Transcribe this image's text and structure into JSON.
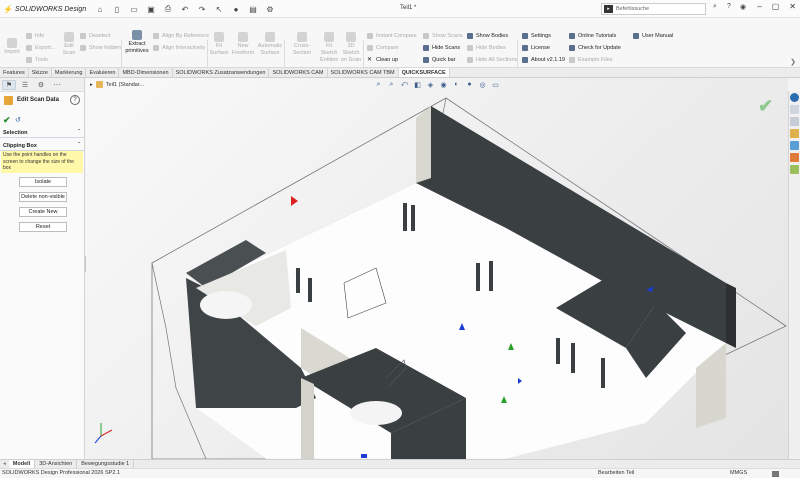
{
  "app": {
    "brand": "SOLIDWORKS Design",
    "document_title": "Teil1 *",
    "search_placeholder": "Befehlssuche",
    "quick_access_icons": [
      "home-icon",
      "new-document-icon",
      "open-icon",
      "save-icon",
      "print-icon",
      "undo-icon",
      "redo-icon",
      "select-icon",
      "rebuild-icon",
      "options-icon"
    ]
  },
  "ribbon": {
    "import_label": "Import",
    "info_label": "Info",
    "export_label": "Export...",
    "tools_label": "Tools",
    "edit_scan_label": "Edit\nScan",
    "deselect_label": "Deselect",
    "show_hidden_label": "Show hidden",
    "extract_primitives_label": "Extract\nprimitives",
    "align_by_reference_label": "Align By Reference",
    "align_interactively_label": "Align Interactively",
    "fit_surface_label": "Fit\nSurface",
    "new_freeform_label": "New\nFreeform",
    "automatic_surface_label": "Automatic\nSurface",
    "cross_section_label": "Cross-Section",
    "fit_sketch_label": "Fit\nSketch\nEntities",
    "sketch_on_scan_label": "3D\nSketch\non Scan",
    "instant_compare_label": "Instant Compare",
    "compare_label": "Compare",
    "clean_up_label": "Clean up",
    "show_scans_label": "Show Scans",
    "hide_scans_label": "Hide Scans",
    "quick_bar_label": "Quick bar",
    "show_bodies_label": "Show Bodies",
    "hide_bodies_label": "Hide Bodies",
    "hide_all_sections_label": "Hide All Sections",
    "settings_label": "Settings",
    "license_label": "License",
    "about_label": "About v2.1.19",
    "online_tutorials_label": "Online Tutorials",
    "check_update_label": "Check for Update",
    "example_files_label": "Example Files",
    "user_manual_label": "User Manual"
  },
  "tabs": [
    {
      "label": "Features",
      "selected": false
    },
    {
      "label": "Skizze",
      "selected": false
    },
    {
      "label": "Markierung",
      "selected": false
    },
    {
      "label": "Evaluieren",
      "selected": false
    },
    {
      "label": "MBD-Dimensionen",
      "selected": false
    },
    {
      "label": "SOLIDWORKS Zusatzanwendungen",
      "selected": false
    },
    {
      "label": "SOLIDWORKS CAM",
      "selected": false
    },
    {
      "label": "SOLIDWORKS CAM TBM",
      "selected": false
    },
    {
      "label": "QUICKSURFACE",
      "selected": true
    }
  ],
  "property_manager": {
    "title": "Edit Scan Data",
    "selection_label": "Selection",
    "clipping_box_label": "Clipping Box",
    "hint_text": "Use the point handles on the screen to change the size of the box",
    "buttons": [
      "Isolate",
      "Delete non-visible",
      "Create New",
      "Reset"
    ]
  },
  "viewport": {
    "tree_item": "Teil1 (Standar..."
  },
  "bottom_tabs": [
    {
      "label": "Modell",
      "selected": true
    },
    {
      "label": "3D-Ansichten",
      "selected": false
    },
    {
      "label": "Bewegungsstudie 1",
      "selected": false
    }
  ],
  "status": {
    "product": "SOLIDWORKS Design Professional 2026 SP2.1",
    "mode": "Bearbeiten Teil",
    "units": "MMGS"
  },
  "colors": {
    "brand_red": "#c8102e",
    "wall_dark": "#3a3f41",
    "accept_green": "#8fc98f",
    "hint_yellow": "#fff8a8"
  }
}
